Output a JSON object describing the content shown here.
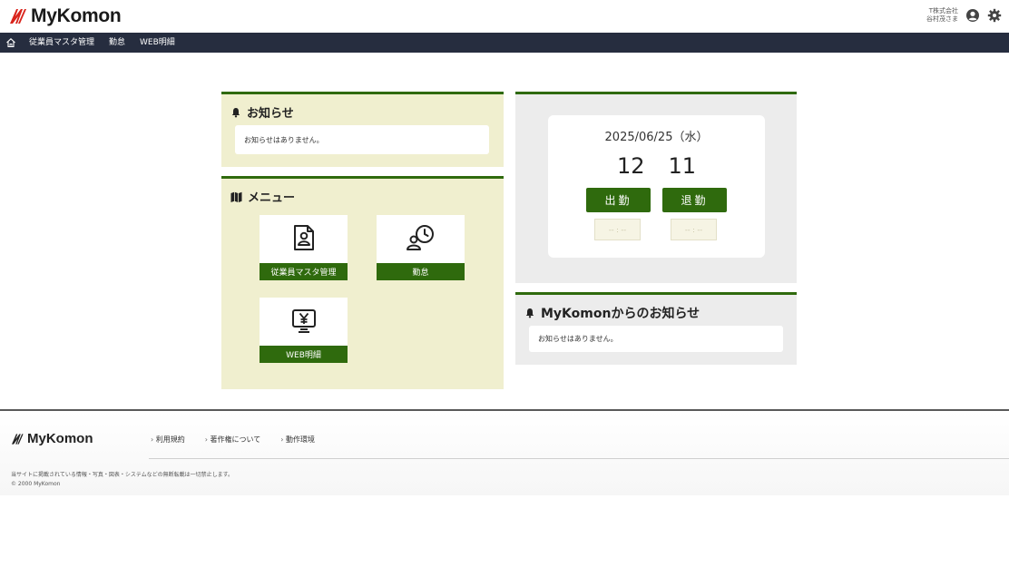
{
  "header": {
    "brand": "MyKomon",
    "company": "T株式会社",
    "user": "谷村茂さま",
    "icons": [
      "user-circle-icon",
      "gear-icon"
    ]
  },
  "nav": {
    "home_icon": "home-icon",
    "items": [
      "従業員マスタ管理",
      "勤怠",
      "WEB明細"
    ]
  },
  "notice": {
    "title": "お知らせ",
    "empty": "お知らせはありません。"
  },
  "menu": {
    "title": "メニュー",
    "items": [
      {
        "label": "従業員マスタ管理",
        "icon": "employee-card-icon"
      },
      {
        "label": "勤怠",
        "icon": "attendance-clock-icon"
      },
      {
        "label": "WEB明細",
        "icon": "yen-monitor-icon"
      }
    ]
  },
  "clock": {
    "date": "2025/06/25（水）",
    "hour": "12",
    "minute": "11",
    "clock_in_label": "出勤",
    "clock_out_label": "退勤",
    "clock_in_time": "-- : --",
    "clock_out_time": "-- : --"
  },
  "mykomon_notice": {
    "title": "MyKomonからのお知らせ",
    "empty": "お知らせはありません。"
  },
  "footer": {
    "brand": "MyKomon",
    "links": [
      "利用規約",
      "著作権について",
      "動作環境"
    ],
    "note": "当サイトに掲載されている情報・写真・図表・システムなどの無断転載は一切禁止します。",
    "copyright": "© 2000 MyKomon"
  },
  "colors": {
    "accent": "#2f6a0d",
    "panel_bg": "#f0efcf",
    "nav_bg": "#262d3f"
  }
}
